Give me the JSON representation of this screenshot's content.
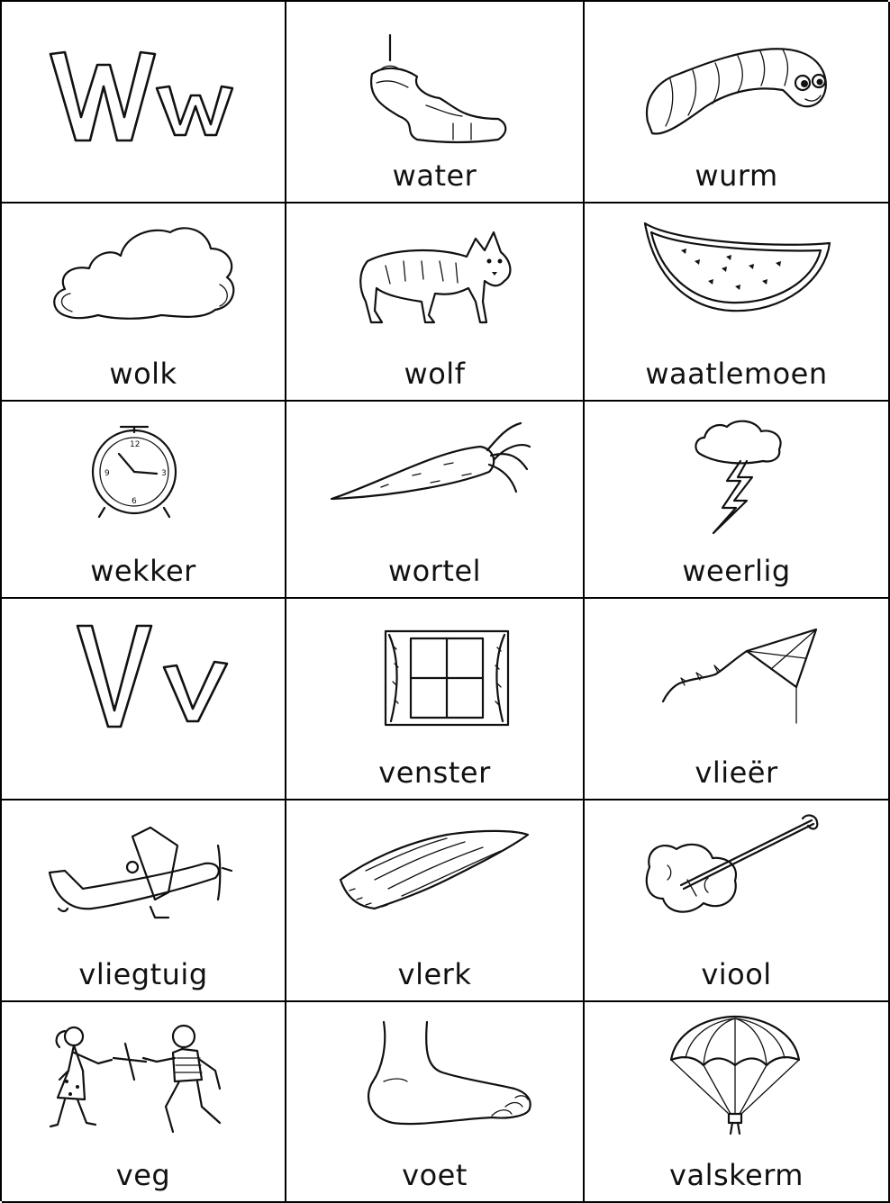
{
  "cards": [
    {
      "word": "",
      "letter": "Ww",
      "icon": "letter-w-icon"
    },
    {
      "word": "water",
      "icon": "water-stream-icon"
    },
    {
      "word": "wurm",
      "icon": "worm-icon"
    },
    {
      "word": "wolk",
      "icon": "cloud-icon"
    },
    {
      "word": "wolf",
      "icon": "wolf-icon"
    },
    {
      "word": "waatlemoen",
      "icon": "watermelon-icon"
    },
    {
      "word": "wekker",
      "icon": "alarm-clock-icon"
    },
    {
      "word": "wortel",
      "icon": "carrot-icon"
    },
    {
      "word": "weerlig",
      "icon": "lightning-icon"
    },
    {
      "word": "",
      "letter": "Vv",
      "icon": "letter-v-icon"
    },
    {
      "word": "venster",
      "icon": "window-icon"
    },
    {
      "word": "vlieër",
      "icon": "kite-icon"
    },
    {
      "word": "vliegtuig",
      "icon": "airplane-icon"
    },
    {
      "word": "vlerk",
      "icon": "wing-icon"
    },
    {
      "word": "viool",
      "icon": "violin-icon"
    },
    {
      "word": "veg",
      "icon": "children-fighting-icon"
    },
    {
      "word": "voet",
      "icon": "foot-icon"
    },
    {
      "word": "valskerm",
      "icon": "parachute-icon"
    }
  ]
}
